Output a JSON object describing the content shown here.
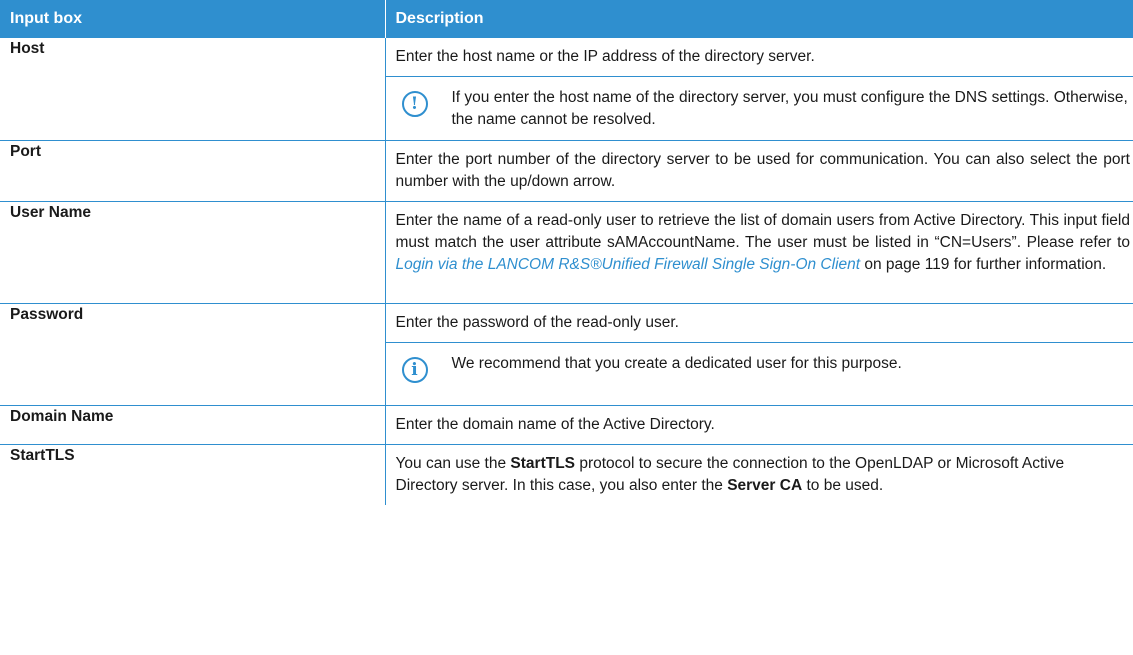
{
  "header": {
    "col1": "Input box",
    "col2": "Description"
  },
  "rows": {
    "host": {
      "name": "Host",
      "desc": "Enter the host name or the IP address of the directory server.",
      "note": "If you enter the host name of the directory server, you must configure the DNS settings. Otherwise, the name cannot be resolved.",
      "note_icon": "!"
    },
    "port": {
      "name": "Port",
      "desc": "Enter the port number of the directory server to be used for communication. You can also select the port number with the up/down arrow."
    },
    "user": {
      "name": "User Name",
      "desc_pre": "Enter the name of a read-only user to retrieve the list of domain users from Active Directory. This input field must match the user attribute sAMAccountName. The user must be listed in “CN=Users”. Please refer to ",
      "link": "Login via the LANCOM R&S®Unified Firewall Single Sign-On Client",
      "desc_post": " on page 119 for further information."
    },
    "password": {
      "name": "Password",
      "desc": "Enter the password of the read-only user.",
      "note": "We recommend that you create a dedicated user for this purpose.",
      "note_icon": "i"
    },
    "domain": {
      "name": "Domain Name",
      "desc": "Enter the domain name of the Active Directory."
    },
    "starttls": {
      "name": "StartTLS",
      "desc_1": "You can use the ",
      "bold_1": "StartTLS",
      "desc_2": " protocol to secure the connection to the OpenLDAP or Microsoft Active Directory server. In this case, you also enter the ",
      "bold_2": "Server CA",
      "desc_3": " to be used."
    }
  },
  "colors": {
    "accent": "#2f8fcf"
  },
  "icons": {
    "warning": "exclamation-circle-icon",
    "info": "info-circle-icon"
  }
}
